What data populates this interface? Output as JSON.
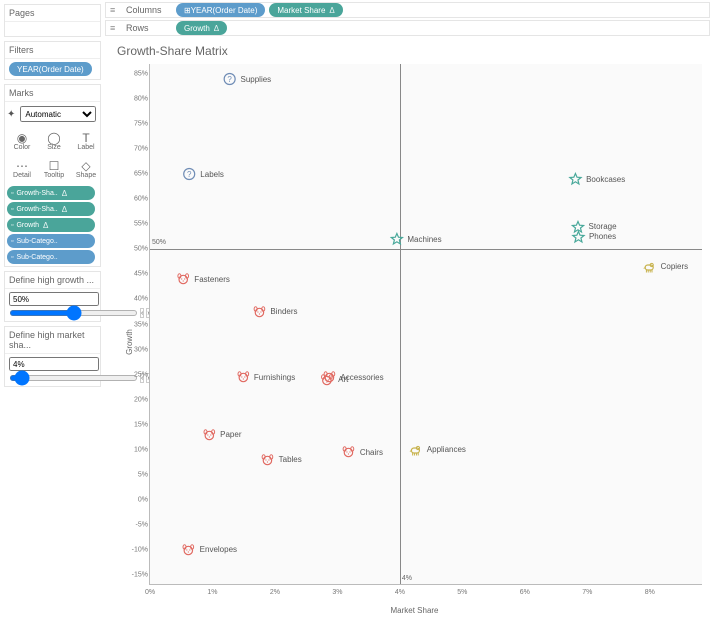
{
  "sidebar": {
    "pages_title": "Pages",
    "filters_title": "Filters",
    "filter_pill": "YEAR(Order Date)",
    "marks_title": "Marks",
    "marks_type": "Automatic",
    "mark_btns": [
      "Color",
      "Size",
      "Label",
      "Detail",
      "Tooltip",
      "Shape"
    ],
    "mark_pills": [
      {
        "label": "Growth-Sha..",
        "cls": "teal",
        "sym": "Δ"
      },
      {
        "label": "Growth-Sha..",
        "cls": "teal",
        "sym": "Δ"
      },
      {
        "label": "Growth",
        "cls": "teal",
        "sym": "Δ"
      },
      {
        "label": "Sub-Catego..",
        "cls": "blue",
        "sym": ""
      },
      {
        "label": "Sub-Catego..",
        "cls": "blue",
        "sym": ""
      }
    ],
    "param1_title": "Define high growth ...",
    "param1_value": "50%",
    "param2_title": "Define high market sha...",
    "param2_value": "4%"
  },
  "shelves": {
    "columns_label": "Columns",
    "rows_label": "Rows",
    "col_pill1": "YEAR(Order Date)",
    "col_pill2": "Market Share",
    "row_pill1": "Growth"
  },
  "chart": {
    "title": "Growth-Share Matrix",
    "xlabel": "Market Share",
    "ylabel": "Growth",
    "ref_vline_label": "4%",
    "ref_hline_label": "50%"
  },
  "chart_data": {
    "type": "scatter",
    "xlabel": "Market Share",
    "ylabel": "Growth",
    "xlim": [
      0,
      8.5
    ],
    "ylim": [
      -17,
      87
    ],
    "x_ticks": [
      0,
      1,
      2,
      3,
      4,
      5,
      6,
      7,
      8
    ],
    "y_ticks": [
      -15,
      -10,
      -5,
      0,
      5,
      10,
      15,
      20,
      25,
      30,
      35,
      40,
      45,
      50,
      55,
      60,
      65,
      70,
      75,
      80,
      85
    ],
    "reference_lines": {
      "x": 4,
      "y": 50
    },
    "points": [
      {
        "name": "Supplies",
        "x": 1.55,
        "y": 84,
        "quadrant": "question"
      },
      {
        "name": "Labels",
        "x": 0.85,
        "y": 65,
        "quadrant": "question"
      },
      {
        "name": "Bookcases",
        "x": 7.15,
        "y": 64,
        "quadrant": "star"
      },
      {
        "name": "Storage",
        "x": 7.1,
        "y": 54.5,
        "quadrant": "star"
      },
      {
        "name": "Phones",
        "x": 7.1,
        "y": 52.5,
        "quadrant": "star"
      },
      {
        "name": "Machines",
        "x": 4.25,
        "y": 52,
        "quadrant": "star"
      },
      {
        "name": "Copiers",
        "x": 8.25,
        "y": 46.5,
        "quadrant": "cow"
      },
      {
        "name": "Fasteners",
        "x": 0.85,
        "y": 44,
        "quadrant": "dog"
      },
      {
        "name": "Binders",
        "x": 2.0,
        "y": 37.5,
        "quadrant": "dog"
      },
      {
        "name": "Furnishings",
        "x": 1.85,
        "y": 24.5,
        "quadrant": "dog"
      },
      {
        "name": "Art",
        "x": 2.95,
        "y": 24,
        "quadrant": "dog"
      },
      {
        "name": "Accessories",
        "x": 3.25,
        "y": 24.5,
        "quadrant": "dog"
      },
      {
        "name": "Paper",
        "x": 1.15,
        "y": 13,
        "quadrant": "dog"
      },
      {
        "name": "Tables",
        "x": 2.1,
        "y": 8,
        "quadrant": "dog"
      },
      {
        "name": "Chairs",
        "x": 3.4,
        "y": 9.5,
        "quadrant": "dog"
      },
      {
        "name": "Appliances",
        "x": 4.6,
        "y": 10,
        "quadrant": "cow"
      },
      {
        "name": "Envelopes",
        "x": 0.95,
        "y": -10,
        "quadrant": "dog"
      }
    ]
  }
}
